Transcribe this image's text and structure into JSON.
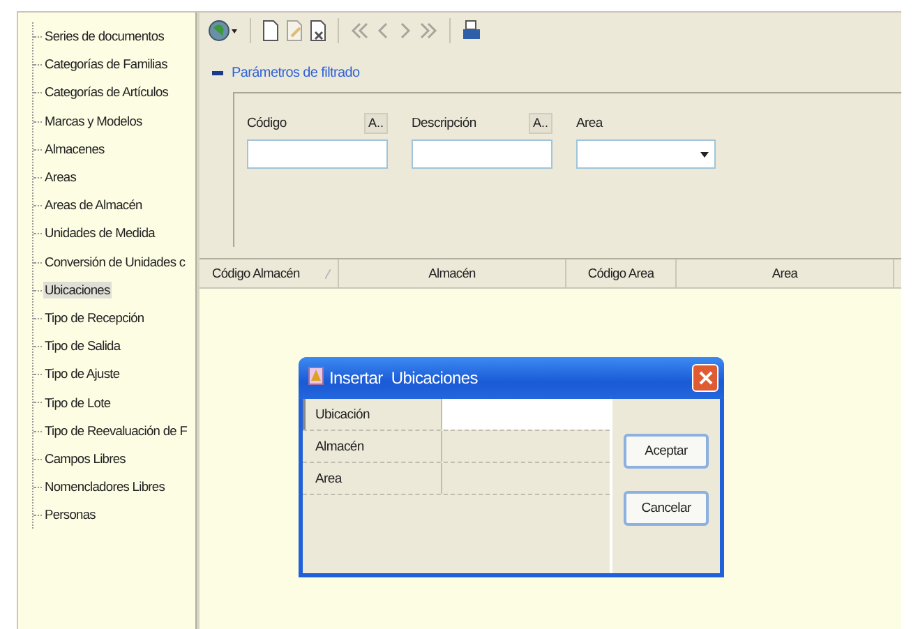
{
  "sidebar": {
    "items": [
      {
        "label": "Series de documentos",
        "selected": false
      },
      {
        "label": "Categorías de Familias",
        "selected": false
      },
      {
        "label": "Categorías de Artículos",
        "selected": false
      },
      {
        "label": "Marcas y Modelos",
        "selected": false
      },
      {
        "label": "Almacenes",
        "selected": false
      },
      {
        "label": "Areas",
        "selected": false
      },
      {
        "label": "Areas de Almacén",
        "selected": false
      },
      {
        "label": "Unidades de Medida",
        "selected": false
      },
      {
        "label": "Conversión de Unidades c",
        "selected": false
      },
      {
        "label": "Ubicaciones",
        "selected": true
      },
      {
        "label": "Tipo de Recepción",
        "selected": false
      },
      {
        "label": "Tipo de Salida",
        "selected": false
      },
      {
        "label": "Tipo de Ajuste",
        "selected": false
      },
      {
        "label": "Tipo de Lote",
        "selected": false
      },
      {
        "label": "Tipo de Reevaluación de F",
        "selected": false
      },
      {
        "label": "Campos Libres",
        "selected": false
      },
      {
        "label": "Nomencladores Libres",
        "selected": false
      },
      {
        "label": "Personas",
        "selected": false
      }
    ]
  },
  "toolbar": [
    {
      "kind": "globe",
      "disabled": false
    },
    {
      "kind": "sep"
    },
    {
      "kind": "new",
      "disabled": false
    },
    {
      "kind": "edit",
      "disabled": true
    },
    {
      "kind": "delete",
      "disabled": false
    },
    {
      "kind": "sep"
    },
    {
      "kind": "first",
      "disabled": true
    },
    {
      "kind": "prev",
      "disabled": true
    },
    {
      "kind": "next",
      "disabled": true
    },
    {
      "kind": "last",
      "disabled": true
    },
    {
      "kind": "sep"
    },
    {
      "kind": "print",
      "disabled": false
    }
  ],
  "filter": {
    "title": "Parámetros de filtrado",
    "expanded": true,
    "fields": [
      {
        "kind": "text",
        "label": "Código",
        "button": "A.."
      },
      {
        "kind": "text",
        "label": "Descripción",
        "button": "A.."
      },
      {
        "kind": "select",
        "label": "Area"
      }
    ]
  },
  "table": {
    "columns": [
      {
        "label": "Código Almacén",
        "sorted": true
      },
      {
        "label": "Almacén",
        "sorted": false
      },
      {
        "label": "Código Area",
        "sorted": false
      },
      {
        "label": "Area",
        "sorted": false
      }
    ]
  },
  "dialog": {
    "title": "Insertar  Ubicaciones",
    "rows": [
      {
        "label": "Ubicación",
        "selected": true
      },
      {
        "label": "Almacén",
        "selected": false
      },
      {
        "label": "Area",
        "selected": false
      }
    ],
    "buttons": [
      "Aceptar",
      "Cancelar"
    ]
  }
}
